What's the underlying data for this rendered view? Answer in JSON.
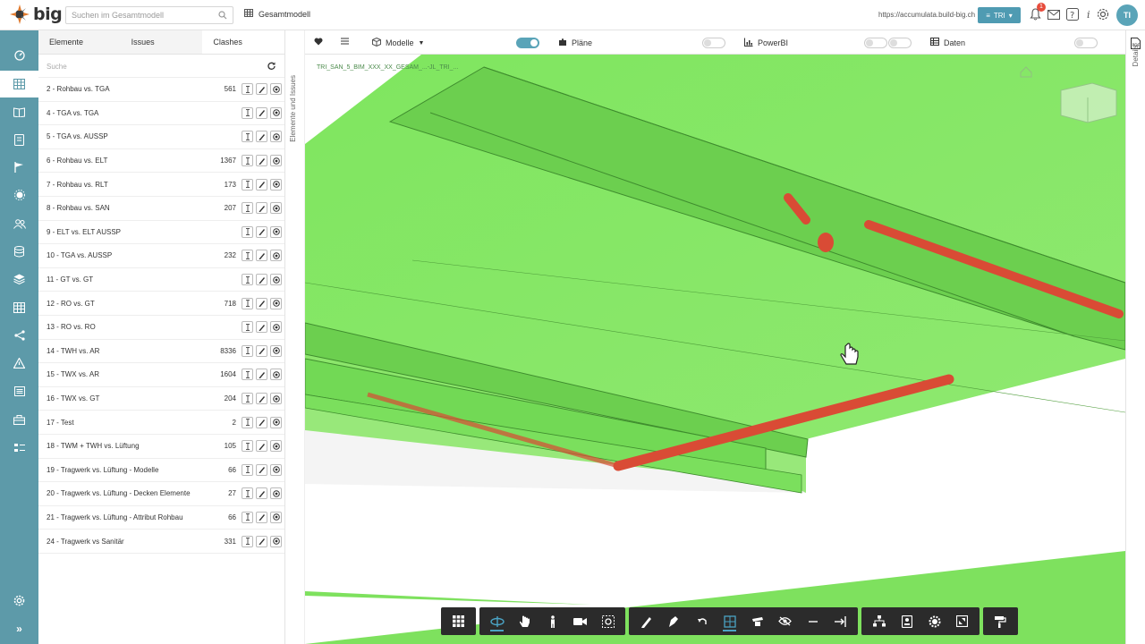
{
  "header": {
    "logo_text": "big",
    "search_placeholder": "Suchen im Gesamtmodell",
    "model_label": "Gesamtmodell",
    "url": "https://accumulata.build-big.ch",
    "user_button": "TRI",
    "notification_count": "1",
    "avatar_initials": "TI"
  },
  "panel": {
    "tabs": [
      "Elemente",
      "Issues",
      "Clashes"
    ],
    "active_tab": "Clashes",
    "search_placeholder": "Suche",
    "rows": [
      {
        "name": "2 - Rohbau vs. TGA",
        "count": "561"
      },
      {
        "name": "4 - TGA vs. TGA",
        "count": ""
      },
      {
        "name": "5 - TGA vs. AUSSP",
        "count": ""
      },
      {
        "name": "6 - Rohbau vs. ELT",
        "count": "1367"
      },
      {
        "name": "7 - Rohbau vs. RLT",
        "count": "173"
      },
      {
        "name": "8 - Rohbau vs. SAN",
        "count": "207"
      },
      {
        "name": "9 - ELT vs. ELT AUSSP",
        "count": ""
      },
      {
        "name": "10 - TGA vs. AUSSP",
        "count": "232"
      },
      {
        "name": "11 - GT vs. GT",
        "count": ""
      },
      {
        "name": "12 - RO vs. GT",
        "count": "718"
      },
      {
        "name": "13 - RO vs. RO",
        "count": ""
      },
      {
        "name": "14 - TWH vs. AR",
        "count": "8336"
      },
      {
        "name": "15 - TWX vs. AR",
        "count": "1604"
      },
      {
        "name": "16 - TWX vs. GT",
        "count": "204"
      },
      {
        "name": "17 - Test",
        "count": "2"
      },
      {
        "name": "18 - TWM + TWH vs. Lüftung",
        "count": "105"
      },
      {
        "name": "19 - Tragwerk vs. Lüftung - Modelle",
        "count": "66"
      },
      {
        "name": "20 - Tragwerk vs. Lüftung - Decken Elemente",
        "count": "27"
      },
      {
        "name": "21 - Tragwerk vs. Lüftung - Attribut Rohbau",
        "count": "66"
      },
      {
        "name": "24 - Tragwerk vs Sanitär",
        "count": "331"
      }
    ]
  },
  "side_label": "Elemente und Issues",
  "details_label": "Details",
  "toolbar": {
    "modelle_label": "Modelle",
    "plaene_label": "Pläne",
    "powerbi_label": "PowerBI",
    "daten_label": "Daten"
  },
  "viewport": {
    "model_path": "TRI_SAN_5_BIM_XXX_XX_GESAM_...-JL_TRI_..."
  },
  "colors": {
    "rail": "#5d9aa9",
    "accent": "#4aa3c4",
    "model_green": "#7ee15e",
    "clash_red": "#d94b35"
  }
}
